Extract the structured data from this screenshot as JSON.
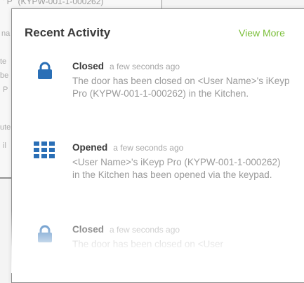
{
  "background_window": {
    "fragments": [
      "' P' '(KYPW-001-1-000262)",
      "na",
      "te",
      "be",
      "P",
      "ute",
      "il"
    ]
  },
  "recent_activity": {
    "title": "Recent Activity",
    "view_more_label": "View More",
    "entries": [
      {
        "icon": "lock-icon",
        "status": "Closed",
        "time": "a few seconds ago",
        "message": "The door has been closed on <User Name>'s iKeyp Pro (KYPW-001-1-000262) in the Kitchen."
      },
      {
        "icon": "keypad-icon",
        "status": "Opened",
        "time": "a few seconds ago",
        "message": "<User Name>'s iKeyp Pro (KYPW-001-1-000262) in the Kitchen has been opened via the keypad."
      },
      {
        "icon": "lock-icon",
        "status": "Closed",
        "time": "a few seconds ago",
        "message": "The door has been closed on <User"
      }
    ]
  },
  "colors": {
    "accent_blue": "#2a6fb6",
    "link_green": "#7bbf3a"
  }
}
